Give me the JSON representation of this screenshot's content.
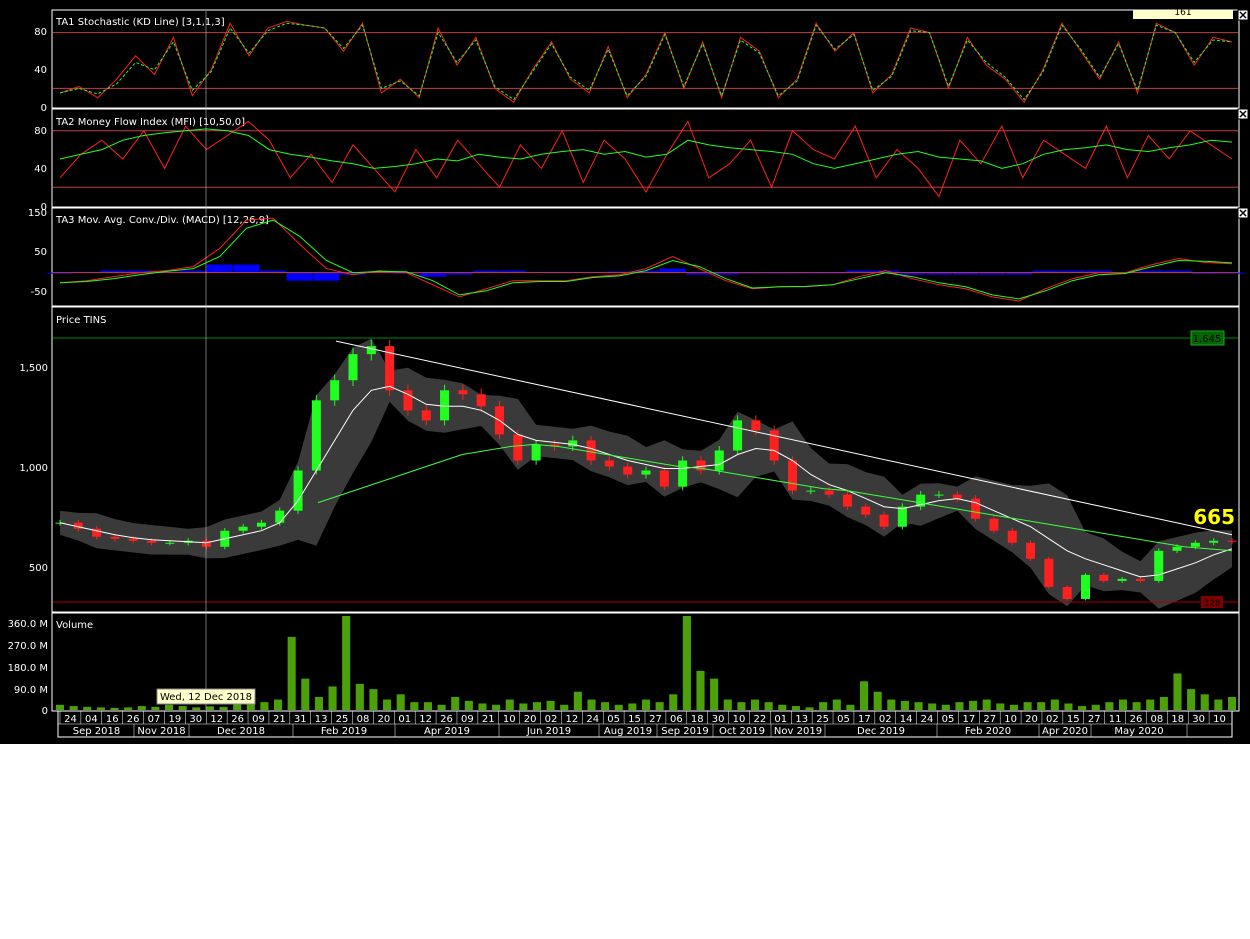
{
  "panels": {
    "stoch": {
      "title": "TA1 Stochastic (KD Line) [3,1,1,3]",
      "y_ticks": [
        "80",
        "40",
        "0"
      ],
      "top_right_badge": "161"
    },
    "mfi": {
      "title": "TA2 Money Flow Index (MFI) [10,50,0]",
      "y_ticks": [
        "80",
        "40",
        "0"
      ]
    },
    "macd": {
      "title": "TA3 Mov. Avg. Conv./Div. (MACD) [12,26,9]",
      "y_ticks": [
        "150",
        "50",
        "-50"
      ]
    },
    "price": {
      "title": "Price TINS",
      "y_ticks": [
        "1,500",
        "1,000",
        "500"
      ],
      "high_marker": "1,645",
      "low_marker": "328",
      "last_price": "665"
    },
    "volume": {
      "title": "Volume",
      "y_ticks": [
        "360.0 M",
        "270.0 M",
        "180.0 M",
        "90.0 M",
        "0"
      ]
    }
  },
  "crosshair_label": "Wed, 12 Dec 2018",
  "x_axis": {
    "days": [
      "24",
      "04",
      "16",
      "26",
      "07",
      "19",
      "30",
      "12",
      "26",
      "09",
      "21",
      "31",
      "13",
      "25",
      "08",
      "20",
      "01",
      "12",
      "26",
      "09",
      "21",
      "10",
      "20",
      "02",
      "12",
      "24",
      "05",
      "15",
      "27",
      "06",
      "18",
      "30",
      "10",
      "22",
      "01",
      "13",
      "25",
      "05",
      "17",
      "02",
      "14",
      "24",
      "05",
      "17",
      "27",
      "10",
      "20",
      "02",
      "15",
      "27",
      "11",
      "26",
      "08",
      "18",
      "30",
      "10"
    ],
    "months": [
      "Sep 2018",
      "Nov 2018",
      "Dec 2018",
      "Feb 2019",
      "Apr 2019",
      "Jun 2019",
      "Aug 2019",
      "Sep 2019",
      "Oct 2019",
      "Nov 2019",
      "Dec 2019",
      "Feb 2020",
      "Apr 2020",
      "May 2020"
    ]
  },
  "colors": {
    "k_line": "#ff2020",
    "d_line": "#20ff20",
    "bullish": "#20ff20",
    "bearish": "#ff2020",
    "bollinger_fill": "#404040",
    "macd_hist": "#0000ff",
    "volume": "#4ca00a",
    "high_marker_bg": "#006600",
    "low_marker_bg": "#800000",
    "last_price": "#ffff00"
  },
  "chart_data": [
    {
      "type": "line",
      "title": "TA1 Stochastic (KD Line) [3,1,1,3]",
      "ylim": [
        0,
        100
      ],
      "reference_lines": [
        80,
        20
      ],
      "series": [
        {
          "values": [
            15,
            22,
            10,
            30,
            55,
            35,
            75,
            12,
            40,
            90,
            55,
            85,
            92,
            88,
            85,
            60,
            90,
            15,
            30,
            10,
            85,
            45,
            75,
            20,
            5,
            40,
            70,
            30,
            15,
            65,
            10,
            35,
            80,
            20,
            70,
            10,
            75,
            60,
            10,
            30,
            90,
            60,
            80,
            15,
            35,
            85,
            80,
            20,
            75,
            45,
            30,
            5,
            40,
            90,
            60,
            30,
            70,
            15,
            90,
            80,
            45,
            75,
            70
          ]
        },
        {
          "values": [
            15,
            20,
            14,
            25,
            48,
            40,
            70,
            18,
            38,
            85,
            58,
            82,
            90,
            88,
            85,
            63,
            88,
            20,
            28,
            12,
            80,
            48,
            72,
            22,
            8,
            38,
            68,
            32,
            18,
            62,
            12,
            33,
            78,
            22,
            68,
            12,
            72,
            58,
            12,
            28,
            88,
            62,
            78,
            18,
            33,
            82,
            80,
            22,
            72,
            48,
            32,
            8,
            38,
            88,
            62,
            32,
            68,
            18,
            88,
            80,
            48,
            72,
            70
          ]
        }
      ]
    },
    {
      "type": "line",
      "title": "TA2 Money Flow Index (MFI) [10,50,0]",
      "ylim": [
        0,
        100
      ],
      "reference_lines": [
        80,
        20
      ],
      "series": [
        {
          "values": [
            30,
            55,
            70,
            50,
            80,
            40,
            85,
            60,
            75,
            90,
            70,
            30,
            55,
            25,
            65,
            40,
            15,
            60,
            30,
            70,
            45,
            20,
            65,
            40,
            80,
            25,
            70,
            50,
            15,
            55,
            90,
            30,
            45,
            70,
            20,
            80,
            60,
            50,
            85,
            30,
            60,
            40,
            10,
            70,
            45,
            85,
            30,
            70,
            55,
            40,
            85,
            30,
            75,
            50,
            80,
            65,
            50
          ]
        },
        {
          "values": [
            50,
            55,
            60,
            70,
            75,
            78,
            80,
            82,
            80,
            75,
            60,
            55,
            52,
            48,
            45,
            40,
            42,
            45,
            50,
            48,
            55,
            52,
            50,
            55,
            58,
            60,
            55,
            58,
            52,
            55,
            70,
            65,
            62,
            60,
            58,
            55,
            45,
            40,
            45,
            50,
            55,
            58,
            52,
            50,
            48,
            40,
            45,
            55,
            60,
            62,
            65,
            60,
            58,
            62,
            65,
            70,
            68
          ]
        }
      ]
    },
    {
      "type": "line",
      "title": "TA3 Mov. Avg. Conv./Div. (MACD) [12,26,9]",
      "ylim": [
        -80,
        150
      ],
      "reference_lines": [
        0
      ],
      "series": [
        {
          "values": [
            -25,
            -20,
            -10,
            0,
            5,
            15,
            60,
            130,
            135,
            70,
            10,
            -5,
            5,
            0,
            -30,
            -60,
            -40,
            -20,
            -20,
            -20,
            -10,
            -5,
            10,
            40,
            10,
            -20,
            -40,
            -35,
            -35,
            -30,
            -10,
            5,
            -15,
            -30,
            -40,
            -60,
            -70,
            -40,
            -15,
            0,
            0,
            20,
            35,
            25,
            22
          ]
        },
        {
          "values": [
            -25,
            -22,
            -15,
            -5,
            3,
            10,
            40,
            110,
            130,
            90,
            30,
            0,
            3,
            2,
            -20,
            -55,
            -45,
            -25,
            -22,
            -22,
            -12,
            -8,
            5,
            30,
            15,
            -15,
            -38,
            -35,
            -34,
            -30,
            -15,
            0,
            -10,
            -25,
            -35,
            -55,
            -65,
            -45,
            -20,
            -5,
            -2,
            15,
            30,
            28,
            24
          ]
        }
      ]
    },
    {
      "type": "line",
      "title": "Price TINS",
      "ylim": [
        300,
        1800
      ],
      "high": 1645,
      "low": 328,
      "last": 665,
      "series": [
        {
          "values": [
            740,
            710,
            670,
            660,
            650,
            640,
            640,
            650,
            620,
            700,
            720,
            740,
            800,
            1000,
            1350,
            1450,
            1580,
            1620,
            1400,
            1300,
            1250,
            1400,
            1380,
            1320,
            1180,
            1050,
            1130,
            1120,
            1150,
            1050,
            1020,
            980,
            1000,
            920,
            1050,
            1000,
            1100,
            1250,
            1200,
            1050,
            900,
            900,
            880,
            820,
            780,
            720,
            820,
            880,
            880,
            860,
            760,
            700,
            640,
            560,
            420,
            360,
            480,
            450,
            460,
            450,
            600,
            620,
            640,
            650,
            645
          ]
        },
        {
          "values": [
            740,
            720,
            700,
            680,
            665,
            655,
            650,
            645,
            640,
            660,
            680,
            700,
            740,
            850,
            1000,
            1150,
            1300,
            1400,
            1420,
            1380,
            1330,
            1320,
            1320,
            1300,
            1250,
            1180,
            1150,
            1140,
            1130,
            1110,
            1080,
            1050,
            1030,
            1010,
            1010,
            1020,
            1030,
            1080,
            1110,
            1100,
            1050,
            980,
            930,
            900,
            860,
            820,
            810,
            830,
            850,
            860,
            840,
            800,
            760,
            720,
            660,
            600,
            560,
            530,
            500,
            470,
            480,
            510,
            540,
            580,
            610
          ]
        },
        {
          "values": [
            840,
            880,
            920,
            960,
            1000,
            1040,
            1080,
            1100,
            1120,
            1130,
            1120,
            1100,
            1080,
            1060,
            1040,
            1020,
            1010,
            990,
            970,
            950,
            930,
            910,
            900,
            880,
            860,
            840,
            820,
            800,
            780,
            760,
            740,
            720,
            700,
            680,
            660,
            640,
            620,
            610,
            600
          ]
        }
      ]
    },
    {
      "type": "bar",
      "title": "Volume",
      "ylim": [
        0,
        360
      ],
      "series": [
        {
          "name": "",
          "values": [
            20,
            15,
            12,
            10,
            8,
            10,
            15,
            12,
            20,
            15,
            10,
            14,
            12,
            25,
            60,
            30,
            40,
            280,
            120,
            50,
            90,
            360,
            100,
            80,
            40,
            60,
            30,
            30,
            20,
            50,
            35,
            25,
            20,
            40,
            25,
            30,
            35,
            20,
            70,
            40,
            30,
            20,
            25,
            40,
            30,
            60,
            360,
            150,
            120,
            40,
            30,
            40,
            30,
            20,
            15,
            10,
            30,
            40,
            20,
            110,
            70,
            40,
            35,
            30,
            25,
            20,
            30,
            35,
            40,
            25,
            20,
            30,
            30,
            40,
            25,
            15,
            20,
            30,
            40,
            30,
            40,
            50,
            140,
            80,
            60,
            40,
            50
          ]
        }
      ]
    }
  ]
}
